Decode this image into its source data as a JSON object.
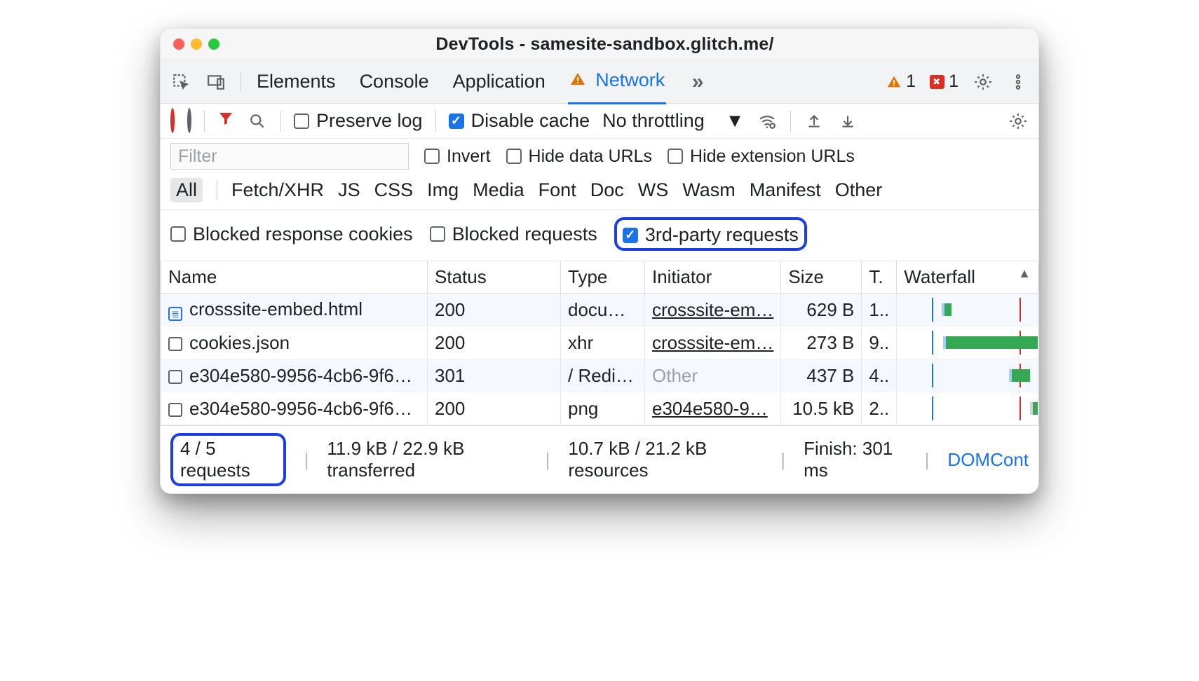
{
  "window": {
    "title": "DevTools - samesite-sandbox.glitch.me/"
  },
  "counters": {
    "warnings": "1",
    "errors": "1"
  },
  "tabs": {
    "items": [
      "Elements",
      "Console",
      "Application",
      "Network"
    ],
    "active_index": 3
  },
  "toolbar": {
    "preserve_log": "Preserve log",
    "disable_cache": "Disable cache",
    "throttling": "No throttling"
  },
  "filter": {
    "placeholder": "Filter",
    "invert": "Invert",
    "hide_data_urls": "Hide data URLs",
    "hide_ext_urls": "Hide extension URLs"
  },
  "type_chips": [
    "All",
    "Fetch/XHR",
    "JS",
    "CSS",
    "Img",
    "Media",
    "Font",
    "Doc",
    "WS",
    "Wasm",
    "Manifest",
    "Other"
  ],
  "extra": {
    "blocked_cookies": "Blocked response cookies",
    "blocked_requests": "Blocked requests",
    "third_party": "3rd-party requests"
  },
  "columns": {
    "name": "Name",
    "status": "Status",
    "type": "Type",
    "initiator": "Initiator",
    "size": "Size",
    "time": "T.",
    "waterfall": "Waterfall"
  },
  "rows": [
    {
      "name": "crosssite-embed.html",
      "icon": "doc",
      "status": "200",
      "type": "docu…",
      "initiator": "crosssite-em…",
      "initiator_link": true,
      "size": "629 B",
      "time": "1.."
    },
    {
      "name": "cookies.json",
      "icon": "box",
      "status": "200",
      "type": "xhr",
      "initiator": "crosssite-em…",
      "initiator_link": true,
      "size": "273 B",
      "time": "9.."
    },
    {
      "name": "e304e580-9956-4cb6-9f6…",
      "icon": "box",
      "status": "301",
      "type": "/ Redi…",
      "initiator": "Other",
      "initiator_link": false,
      "size": "437 B",
      "time": "4.."
    },
    {
      "name": "e304e580-9956-4cb6-9f6…",
      "icon": "box",
      "status": "200",
      "type": "png",
      "initiator": "e304e580-9…",
      "initiator_link": true,
      "size": "10.5 kB",
      "time": "2.."
    }
  ],
  "statusbar": {
    "requests": "4 / 5 requests",
    "transferred": "11.9 kB / 22.9 kB transferred",
    "resources": "10.7 kB / 21.2 kB resources",
    "finish": "Finish: 301 ms",
    "dom": "DOMCont"
  }
}
